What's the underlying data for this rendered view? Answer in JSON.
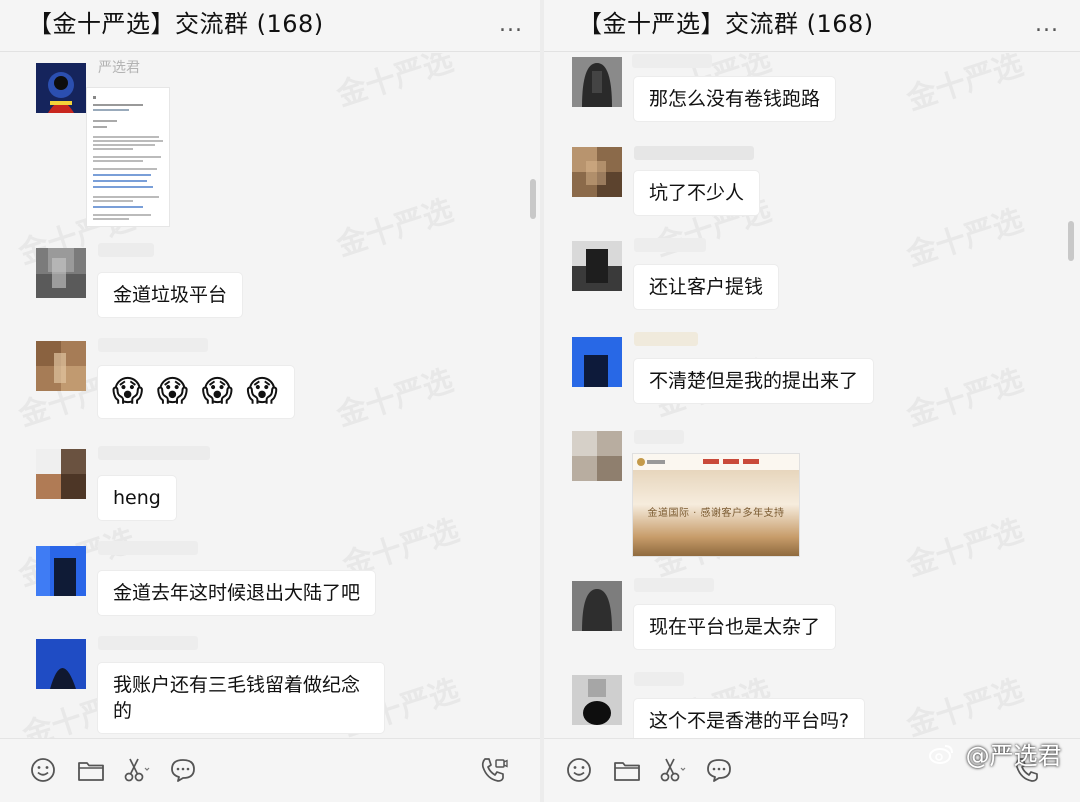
{
  "left": {
    "header": {
      "title": "【金十严选】交流群 (168)",
      "more_label": "..."
    },
    "messages": {
      "m1": {
        "sender": "严选君",
        "attachment_name": "document-screenshot"
      },
      "m2": {
        "text": "金道垃圾平台"
      },
      "m3": {
        "emoji": "😱 😱 😱 😱"
      },
      "m4": {
        "text": "heng"
      },
      "m5": {
        "text": "金道去年这时候退出大陆了吧"
      },
      "m6": {
        "line1": "我账户还有三毛钱留着做纪念",
        "line2": "的"
      }
    }
  },
  "right": {
    "header": {
      "title": "【金十严选】交流群 (168)",
      "more_label": "..."
    },
    "messages": {
      "m1": {
        "text": "那怎么没有卷钱跑路"
      },
      "m2": {
        "text": "坑了不少人"
      },
      "m3": {
        "text": "还让客户提钱"
      },
      "m4": {
        "text": "不清楚但是我的提出来了"
      },
      "m5": {
        "banner_text": "金道国际 · 感谢客户多年支持"
      },
      "m6": {
        "text": "现在平台也是太杂了"
      },
      "m7": {
        "text": "这个不是香港的平台吗?"
      }
    }
  },
  "watermark": {
    "text": "金十严选"
  },
  "attribution": {
    "text": "@严选君"
  },
  "toolbar": {
    "icons": [
      "emoji-icon",
      "folder-icon",
      "scissors-icon",
      "chat-bubble-icon",
      "phone-icon"
    ]
  },
  "colors": {
    "bubble": "#ffffff",
    "pane_bg": "#f4f4f4",
    "header_text": "#111111",
    "icon_stroke": "#555555"
  }
}
